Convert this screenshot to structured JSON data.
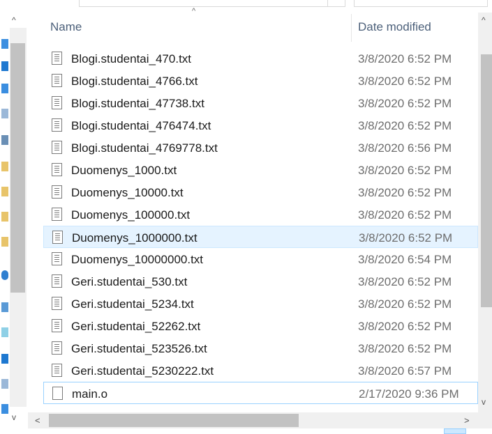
{
  "header": {
    "name": "Name",
    "date_modified": "Date modified",
    "sort_arrow": "^"
  },
  "files": [
    {
      "name": "Blogi.studentai_470.txt",
      "date": "3/8/2020 6:52 PM",
      "type": "txt"
    },
    {
      "name": "Blogi.studentai_4766.txt",
      "date": "3/8/2020 6:52 PM",
      "type": "txt"
    },
    {
      "name": "Blogi.studentai_47738.txt",
      "date": "3/8/2020 6:52 PM",
      "type": "txt"
    },
    {
      "name": "Blogi.studentai_476474.txt",
      "date": "3/8/2020 6:52 PM",
      "type": "txt"
    },
    {
      "name": "Blogi.studentai_4769778.txt",
      "date": "3/8/2020 6:56 PM",
      "type": "txt"
    },
    {
      "name": "Duomenys_1000.txt",
      "date": "3/8/2020 6:52 PM",
      "type": "txt"
    },
    {
      "name": "Duomenys_10000.txt",
      "date": "3/8/2020 6:52 PM",
      "type": "txt"
    },
    {
      "name": "Duomenys_100000.txt",
      "date": "3/8/2020 6:52 PM",
      "type": "txt"
    },
    {
      "name": "Duomenys_1000000.txt",
      "date": "3/8/2020 6:52 PM",
      "type": "txt",
      "selected": true
    },
    {
      "name": "Duomenys_10000000.txt",
      "date": "3/8/2020 6:54 PM",
      "type": "txt"
    },
    {
      "name": "Geri.studentai_530.txt",
      "date": "3/8/2020 6:52 PM",
      "type": "txt"
    },
    {
      "name": "Geri.studentai_5234.txt",
      "date": "3/8/2020 6:52 PM",
      "type": "txt"
    },
    {
      "name": "Geri.studentai_52262.txt",
      "date": "3/8/2020 6:52 PM",
      "type": "txt"
    },
    {
      "name": "Geri.studentai_523526.txt",
      "date": "3/8/2020 6:52 PM",
      "type": "txt"
    },
    {
      "name": "Geri.studentai_5230222.txt",
      "date": "3/8/2020 6:57 PM",
      "type": "txt"
    },
    {
      "name": "main.o",
      "date": "2/17/2020 9:36 PM",
      "type": "blank",
      "focused": true
    }
  ],
  "scroll": {
    "up": "^",
    "down": "v",
    "left": "<",
    "right": ">"
  }
}
